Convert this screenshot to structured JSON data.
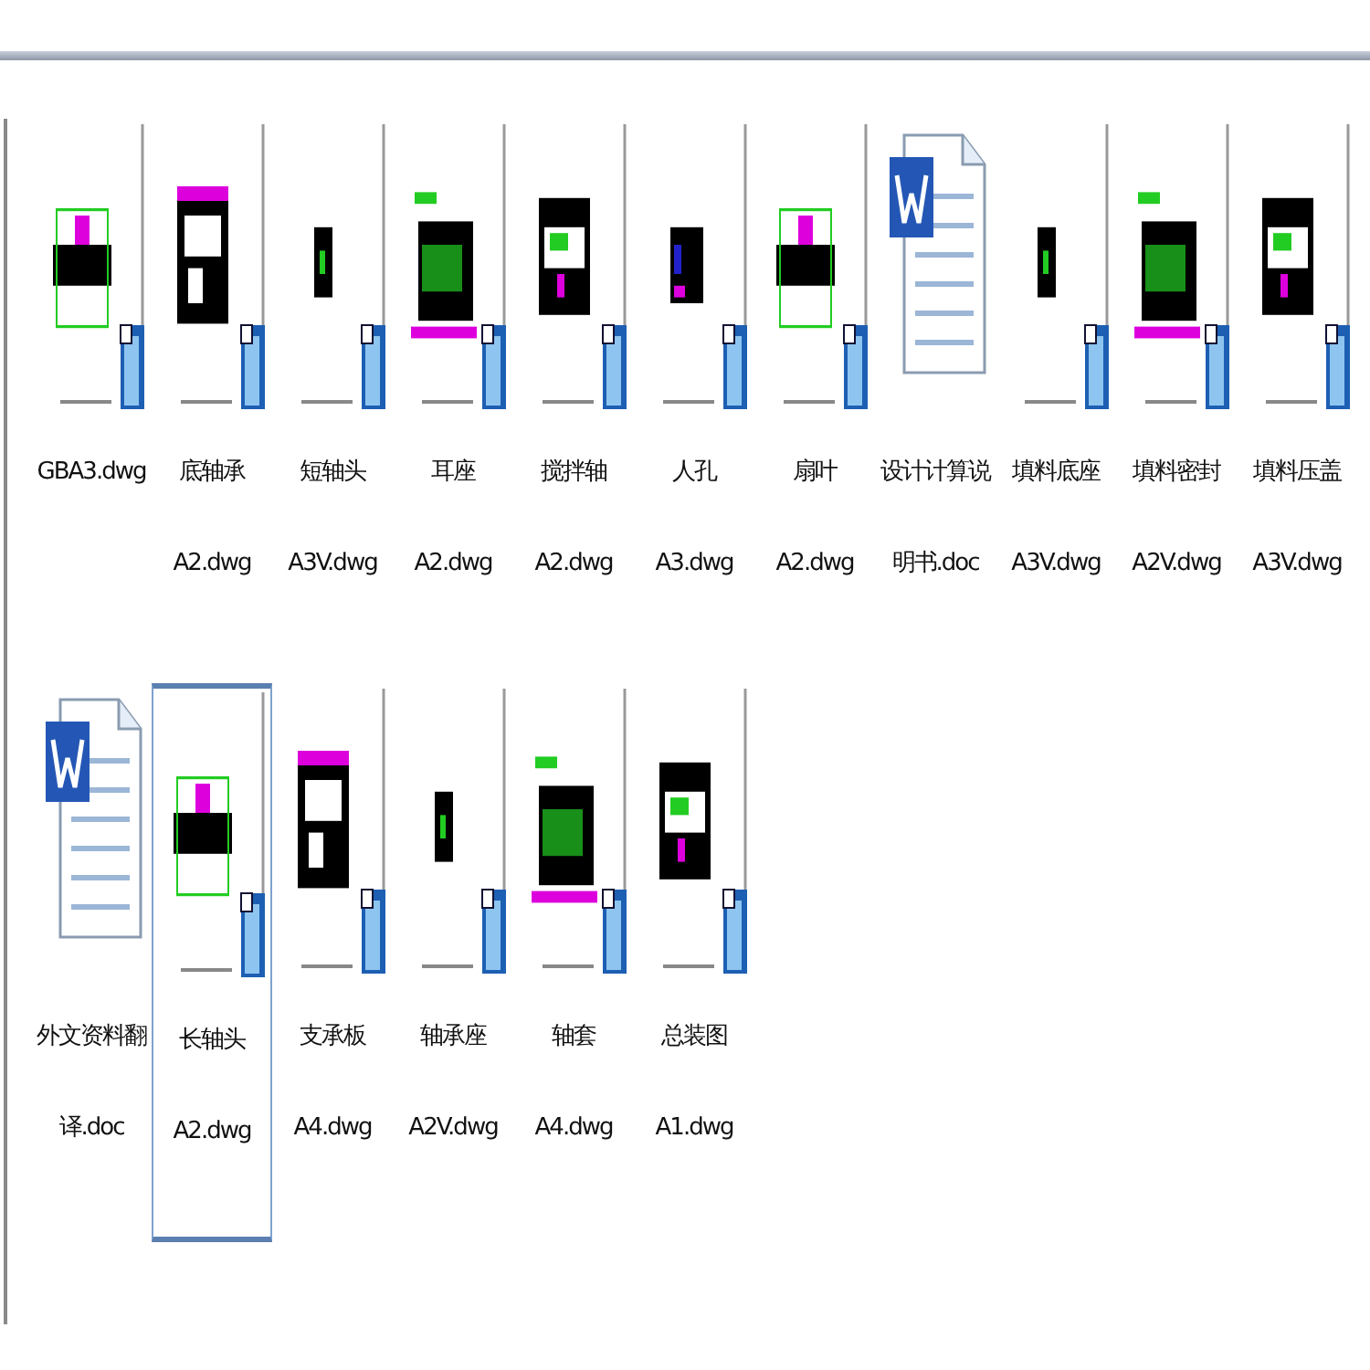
{
  "files": [
    {
      "kind": "dwg",
      "label": [
        "GBA3.dwg"
      ],
      "selected": false
    },
    {
      "kind": "dwg",
      "label": [
        "底轴承",
        "A2.dwg"
      ],
      "selected": false
    },
    {
      "kind": "dwg",
      "label": [
        "短轴头",
        "A3V.dwg"
      ],
      "selected": false
    },
    {
      "kind": "dwg",
      "label": [
        "耳座",
        "A2.dwg"
      ],
      "selected": false
    },
    {
      "kind": "dwg",
      "label": [
        "搅拌轴",
        "A2.dwg"
      ],
      "selected": false
    },
    {
      "kind": "dwg",
      "label": [
        "人孔",
        "A3.dwg"
      ],
      "selected": false
    },
    {
      "kind": "dwg",
      "label": [
        "扇叶",
        "A2.dwg"
      ],
      "selected": false
    },
    {
      "kind": "doc",
      "label": [
        "设计计算说",
        "明书.doc"
      ],
      "selected": false
    },
    {
      "kind": "dwg",
      "label": [
        "填料底座",
        "A3V.dwg"
      ],
      "selected": false
    },
    {
      "kind": "dwg",
      "label": [
        "填料密封",
        "A2V.dwg"
      ],
      "selected": false
    },
    {
      "kind": "dwg",
      "label": [
        "填料压盖",
        "A3V.dwg"
      ],
      "selected": false
    },
    {
      "kind": "doc",
      "label": [
        "外文资料翻",
        "译.doc"
      ],
      "selected": false
    },
    {
      "kind": "dwg",
      "label": [
        "长轴头",
        "A2.dwg"
      ],
      "selected": true
    },
    {
      "kind": "dwg",
      "label": [
        "支承板",
        "A4.dwg"
      ],
      "selected": false
    },
    {
      "kind": "dwg",
      "label": [
        "轴承座",
        "A2V.dwg"
      ],
      "selected": false
    },
    {
      "kind": "dwg",
      "label": [
        "轴套",
        "A4.dwg"
      ],
      "selected": false
    },
    {
      "kind": "dwg",
      "label": [
        "总装图",
        "A1.dwg"
      ],
      "selected": false
    }
  ]
}
